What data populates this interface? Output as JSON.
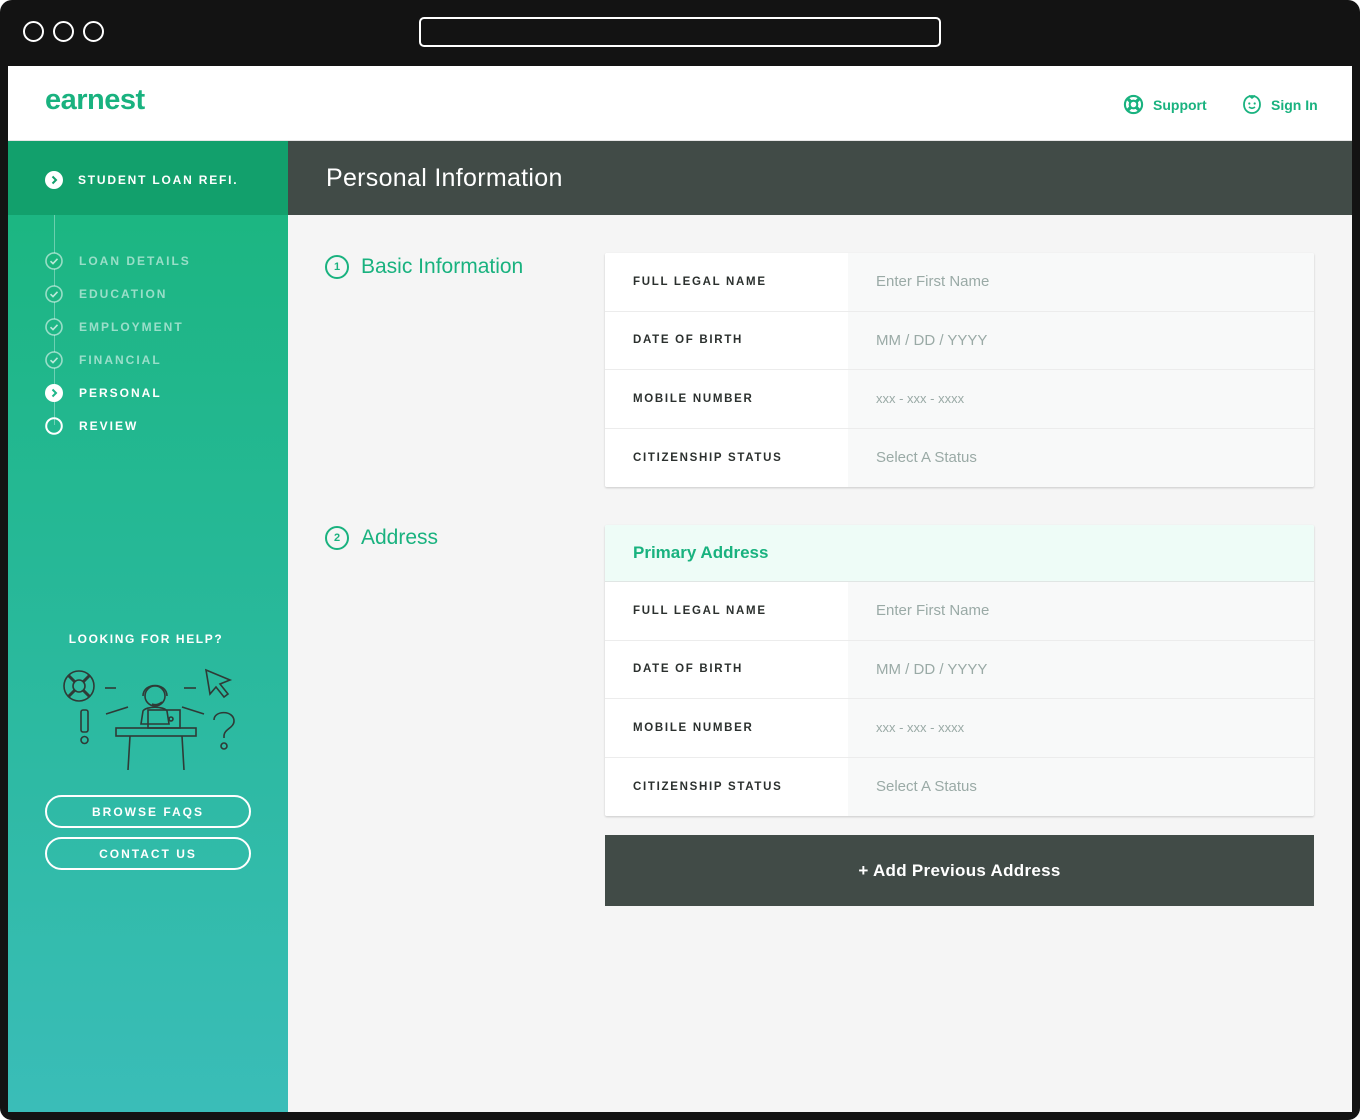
{
  "browser": {
    "url": ""
  },
  "header": {
    "logo": "earnest",
    "support_label": "Support",
    "signin_label": "Sign In",
    "accent_color": "#19b27f"
  },
  "sidebar": {
    "section_label": "STUDENT LOAN REFI.",
    "steps": [
      {
        "label": "LOAN DETAILS",
        "state": "done",
        "icon": "check-circle-icon"
      },
      {
        "label": "EDUCATION",
        "state": "done",
        "icon": "check-circle-icon"
      },
      {
        "label": "EMPLOYMENT",
        "state": "done",
        "icon": "check-circle-icon"
      },
      {
        "label": "FINANCIAL",
        "state": "done",
        "icon": "check-circle-icon"
      },
      {
        "label": "PERSONAL",
        "state": "active",
        "icon": "chevron-circle-icon"
      },
      {
        "label": "REVIEW",
        "state": "upcoming",
        "icon": "empty-circle-icon"
      }
    ],
    "help_title": "LOOKING FOR HELP?",
    "browse_faqs": "BROWSE FAQS",
    "contact_us": "CONTACT US"
  },
  "main": {
    "title": "Personal Information",
    "sections": [
      {
        "number": "1",
        "title": "Basic Information",
        "rows": [
          {
            "label": "FULL LEGAL NAME",
            "placeholder": "Enter First Name"
          },
          {
            "label": "DATE OF BIRTH",
            "placeholder": "MM / DD / YYYY"
          },
          {
            "label": "MOBILE NUMBER",
            "placeholder": "xxx - xxx - xxxx"
          },
          {
            "label": "CITIZENSHIP STATUS",
            "placeholder": "Select A Status"
          }
        ]
      },
      {
        "number": "2",
        "title": "Address",
        "card_title": "Primary Address",
        "rows": [
          {
            "label": "FULL LEGAL NAME",
            "placeholder": "Enter First Name"
          },
          {
            "label": "DATE OF BIRTH",
            "placeholder": "MM / DD / YYYY"
          },
          {
            "label": "MOBILE NUMBER",
            "placeholder": "xxx - xxx - xxxx"
          },
          {
            "label": "CITIZENSHIP STATUS",
            "placeholder": "Select A Status"
          }
        ]
      }
    ],
    "add_previous_address": "+ Add Previous Address"
  }
}
